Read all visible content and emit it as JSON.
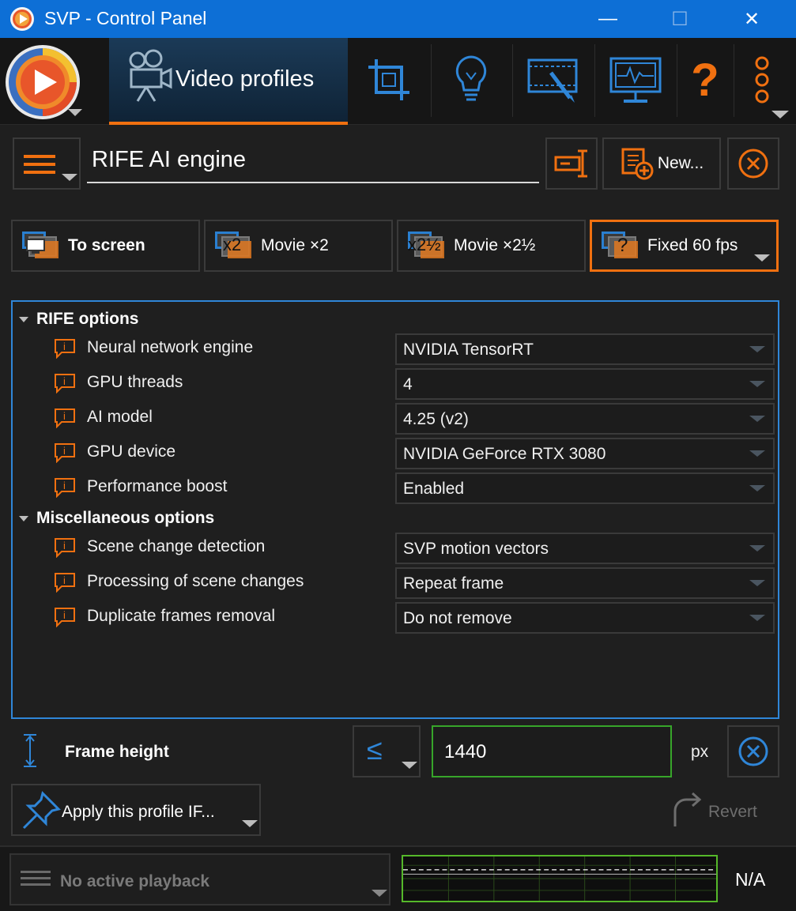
{
  "window": {
    "title": "SVP - Control Panel",
    "minimize_glyph": "—",
    "maximize_glyph": "☐",
    "close_glyph": "✕"
  },
  "toolbar": {
    "active_tab_label": "Video profiles",
    "tabs": [
      {
        "name": "crop-icon"
      },
      {
        "name": "lightbulb-icon"
      },
      {
        "name": "video-edit-icon"
      },
      {
        "name": "monitor-icon"
      },
      {
        "name": "help-icon",
        "glyph": "?"
      },
      {
        "name": "more-icon"
      }
    ],
    "accent_color": "#f07010",
    "icon_color": "#2f86d8"
  },
  "profile": {
    "name": "RIFE AI engine",
    "new_label": "New..."
  },
  "presets": [
    {
      "label": "To screen",
      "bold": true,
      "icon_text": ""
    },
    {
      "label": "Movie ×2",
      "bold": false,
      "icon_text": "x2"
    },
    {
      "label": "Movie ×2½",
      "bold": false,
      "icon_text": "x2½"
    },
    {
      "label": "Fixed 60 fps",
      "bold": false,
      "icon_text": "?",
      "active": true
    }
  ],
  "sections": {
    "rife": {
      "title": "RIFE options",
      "options": [
        {
          "label": "Neural network engine",
          "value": "NVIDIA TensorRT"
        },
        {
          "label": "GPU threads",
          "value": "4"
        },
        {
          "label": "AI model",
          "value": "4.25 (v2)"
        },
        {
          "label": "GPU device",
          "value": "NVIDIA GeForce RTX 3080"
        },
        {
          "label": "Performance boost",
          "value": "Enabled"
        }
      ]
    },
    "misc": {
      "title": "Miscellaneous options",
      "options": [
        {
          "label": "Scene change detection",
          "value": "SVP motion vectors"
        },
        {
          "label": "Processing of scene changes",
          "value": "Repeat frame"
        },
        {
          "label": "Duplicate frames removal",
          "value": "Do not remove"
        }
      ]
    }
  },
  "frame_height": {
    "label": "Frame height",
    "comparator": "≤",
    "value": "1440",
    "unit": "px"
  },
  "apply": {
    "label": "Apply this profile IF...",
    "revert_label": "Revert"
  },
  "status": {
    "playback_label": "No active playback",
    "readout": "N/A",
    "graph_color": "#55b82a"
  }
}
